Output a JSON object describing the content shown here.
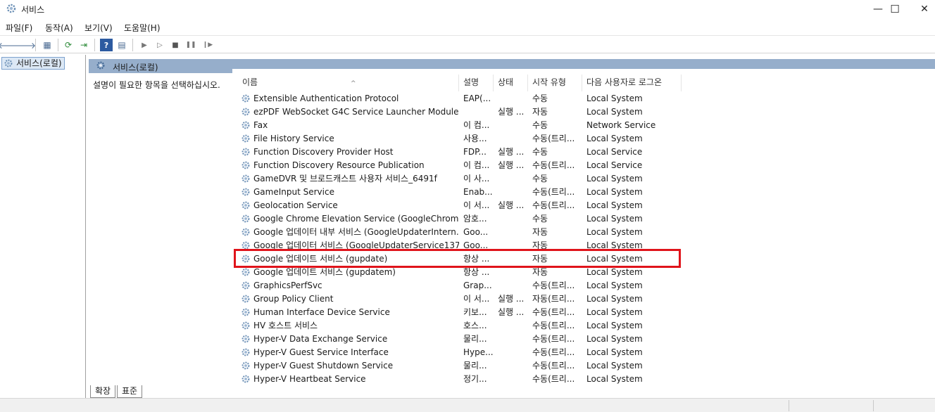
{
  "window": {
    "title": "서비스",
    "minimize": "—",
    "maximize": "☐",
    "close": "✕"
  },
  "menu": [
    "파일(F)",
    "동작(A)",
    "보기(V)",
    "도움말(H)"
  ],
  "toolbar": {
    "back": "🡐",
    "forward": "🡒",
    "show_hide": "▦",
    "refresh": "⟳",
    "export": "⇥",
    "help": "?",
    "properties": "▤",
    "start": "▶",
    "start2": "▷",
    "stop": "■",
    "pause": "❚❚",
    "resume": "❙▶"
  },
  "tree": {
    "root": "서비스(로컬)"
  },
  "pane": {
    "header": "서비스(로컬)",
    "description_prompt": "설명이 필요한 항목을 선택하십시오."
  },
  "columns": {
    "name": "이름",
    "desc": "설명",
    "state": "상태",
    "start": "시작 유형",
    "logon": "다음 사용자로 로그온",
    "sort_arrow": "^"
  },
  "services": [
    {
      "name": "Extensible Authentication Protocol",
      "desc": "EAP(...",
      "state": "",
      "start": "수동",
      "logon": "Local System"
    },
    {
      "name": "ezPDF WebSocket G4C Service Launcher Module",
      "desc": "",
      "state": "실행 ...",
      "start": "자동",
      "logon": "Local System"
    },
    {
      "name": "Fax",
      "desc": "이 컴...",
      "state": "",
      "start": "수동",
      "logon": "Network Service"
    },
    {
      "name": "File History Service",
      "desc": "사용...",
      "state": "",
      "start": "수동(트리...",
      "logon": "Local System"
    },
    {
      "name": "Function Discovery Provider Host",
      "desc": "FDP...",
      "state": "실행 ...",
      "start": "수동",
      "logon": "Local Service"
    },
    {
      "name": "Function Discovery Resource Publication",
      "desc": "이 컴...",
      "state": "실행 ...",
      "start": "수동(트리...",
      "logon": "Local Service"
    },
    {
      "name": "GameDVR 및 브로드캐스트 사용자 서비스_6491f",
      "desc": "이 사...",
      "state": "",
      "start": "수동",
      "logon": "Local System"
    },
    {
      "name": "GameInput Service",
      "desc": "Enab...",
      "state": "",
      "start": "수동(트리...",
      "logon": "Local System"
    },
    {
      "name": "Geolocation Service",
      "desc": "이 서...",
      "state": "실행 ...",
      "start": "수동(트리...",
      "logon": "Local System"
    },
    {
      "name": "Google Chrome Elevation Service (GoogleChromeEl...",
      "desc": "암호...",
      "state": "",
      "start": "수동",
      "logon": "Local System"
    },
    {
      "name": "Google 업데이터 내부 서비스 (GoogleUpdaterIntern...",
      "desc": "Goo...",
      "state": "",
      "start": "자동",
      "logon": "Local System"
    },
    {
      "name": "Google 업데이터 서비스 (GoogleUpdaterService137....",
      "desc": "Goo...",
      "state": "",
      "start": "자동",
      "logon": "Local System"
    },
    {
      "name": "Google 업데이트 서비스 (gupdate)",
      "desc": "항상 ...",
      "state": "",
      "start": "자동",
      "logon": "Local System"
    },
    {
      "name": "Google 업데이트 서비스 (gupdatem)",
      "desc": "항상 ...",
      "state": "",
      "start": "자동",
      "logon": "Local System"
    },
    {
      "name": "GraphicsPerfSvc",
      "desc": "Grap...",
      "state": "",
      "start": "수동(트리...",
      "logon": "Local System"
    },
    {
      "name": "Group Policy Client",
      "desc": "이 서...",
      "state": "실행 ...",
      "start": "자동(트리...",
      "logon": "Local System"
    },
    {
      "name": "Human Interface Device Service",
      "desc": "키보...",
      "state": "실행 ...",
      "start": "수동(트리...",
      "logon": "Local System"
    },
    {
      "name": "HV 호스트 서비스",
      "desc": "호스...",
      "state": "",
      "start": "수동(트리...",
      "logon": "Local System"
    },
    {
      "name": "Hyper-V Data Exchange Service",
      "desc": "물리...",
      "state": "",
      "start": "수동(트리...",
      "logon": "Local System"
    },
    {
      "name": "Hyper-V Guest Service Interface",
      "desc": "Hype...",
      "state": "",
      "start": "수동(트리...",
      "logon": "Local System"
    },
    {
      "name": "Hyper-V Guest Shutdown Service",
      "desc": "물리...",
      "state": "",
      "start": "수동(트리...",
      "logon": "Local System"
    },
    {
      "name": "Hyper-V Heartbeat Service",
      "desc": "정기...",
      "state": "",
      "start": "수동(트리...",
      "logon": "Local System"
    }
  ],
  "tabs": [
    "확장",
    "표준"
  ],
  "icons": {
    "service": "gear-icon",
    "highlight_color": "#e0141b"
  }
}
